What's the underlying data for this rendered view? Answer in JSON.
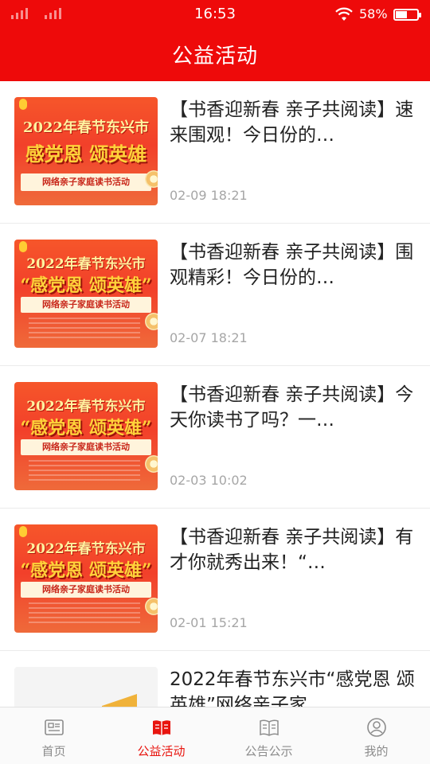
{
  "status_bar": {
    "time": "16:53",
    "battery": "58%"
  },
  "header": {
    "title": "公益活动"
  },
  "articles": [
    {
      "title": "【书香迎新春 亲子共阅读】速来围观！今日份的…",
      "date": "02-09 18:21",
      "thumb_line1": "2022年春节东兴市",
      "thumb_line2": "感党恩 颂英雄",
      "thumb_ribbon": "网络亲子家庭读书活动"
    },
    {
      "title": "【书香迎新春 亲子共阅读】围观精彩！今日份的…",
      "date": "02-07 18:21",
      "thumb_line1": "2022年春节东兴市",
      "thumb_line2": "“感党恩 颂英雄”",
      "thumb_ribbon": "网络亲子家庭读书活动"
    },
    {
      "title": "【书香迎新春 亲子共阅读】今天你读书了吗？一…",
      "date": "02-03 10:02",
      "thumb_line1": "2022年春节东兴市",
      "thumb_line2": "“感党恩 颂英雄”",
      "thumb_ribbon": "网络亲子家庭读书活动"
    },
    {
      "title": "【书香迎新春 亲子共阅读】有才你就秀出来！“…",
      "date": "02-01 15:21",
      "thumb_line1": "2022年春节东兴市",
      "thumb_line2": "“感党恩 颂英雄”",
      "thumb_ribbon": "网络亲子家庭读书活动"
    },
    {
      "title": "2022年春节东兴市“感党恩 颂英雄”网络亲子家…",
      "date": ""
    }
  ],
  "tabbar": {
    "tabs": [
      {
        "label": "首页",
        "icon": "news-icon",
        "active": false
      },
      {
        "label": "公益活动",
        "icon": "book-icon",
        "active": true
      },
      {
        "label": "公告公示",
        "icon": "book-outline-icon",
        "active": false
      },
      {
        "label": "我的",
        "icon": "user-icon",
        "active": false
      }
    ]
  },
  "colors": {
    "brand_red": "#ee0a0a",
    "active_tab": "#e8150f",
    "inactive_tab": "#8c8c8c",
    "date_gray": "#a6a6a6"
  }
}
